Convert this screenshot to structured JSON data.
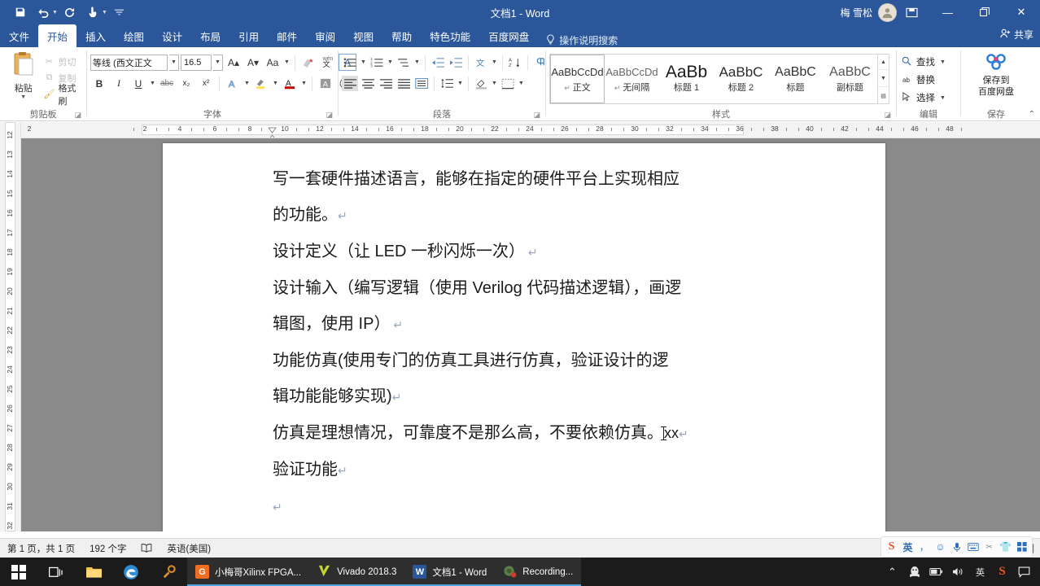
{
  "titlebar": {
    "title": "文档1 - Word",
    "user_name": "梅 雪松",
    "quick_access": [
      {
        "name": "save",
        "glyph": "Ὃe",
        "label": "保存"
      },
      {
        "name": "undo",
        "glyph": "↶",
        "label": "撤消"
      },
      {
        "name": "redo",
        "glyph": "↻",
        "label": "恢复"
      },
      {
        "name": "touch-mode",
        "glyph": "☝",
        "label": "触摸/鼠标模式"
      },
      {
        "name": "customize",
        "glyph": "≡",
        "label": "自定义快速访问工具栏"
      }
    ],
    "ribbon_display_label": "功能区显示选项",
    "minimize_label": "—",
    "restore_label": "❐",
    "close_label": "✕"
  },
  "tabs": {
    "items": [
      {
        "id": "file",
        "label": "文件",
        "active": false
      },
      {
        "id": "home",
        "label": "开始",
        "active": true
      },
      {
        "id": "insert",
        "label": "插入",
        "active": false
      },
      {
        "id": "draw",
        "label": "绘图",
        "active": false
      },
      {
        "id": "design",
        "label": "设计",
        "active": false
      },
      {
        "id": "layout",
        "label": "布局",
        "active": false
      },
      {
        "id": "references",
        "label": "引用",
        "active": false
      },
      {
        "id": "mailings",
        "label": "邮件",
        "active": false
      },
      {
        "id": "review",
        "label": "审阅",
        "active": false
      },
      {
        "id": "view",
        "label": "视图",
        "active": false
      },
      {
        "id": "help",
        "label": "帮助",
        "active": false
      },
      {
        "id": "features",
        "label": "特色功能",
        "active": false
      },
      {
        "id": "baidu",
        "label": "百度网盘",
        "active": false
      }
    ],
    "tell_me": "操作说明搜索",
    "share": "共享"
  },
  "ribbon": {
    "clipboard": {
      "group_label": "剪贴板",
      "paste_label": "粘贴",
      "items": [
        {
          "label": "剪切",
          "icon": "✂",
          "enabled": false
        },
        {
          "label": "复制",
          "icon": "⧉",
          "enabled": false
        },
        {
          "label": "格式刷",
          "icon": "✒",
          "enabled": true
        }
      ]
    },
    "font": {
      "group_label": "字体",
      "font_name": "等线 (西文正文",
      "font_size": "16.5",
      "buttons_row1": [
        {
          "name": "grow-font",
          "label": "A▴"
        },
        {
          "name": "shrink-font",
          "label": "A▾"
        },
        {
          "name": "change-case",
          "label": "Aa"
        },
        {
          "name": "clear-formatting",
          "label": "✐"
        },
        {
          "name": "phonetic-guide",
          "label": "wén文"
        },
        {
          "name": "character-border",
          "label": "A"
        }
      ],
      "buttons_row2": [
        {
          "name": "bold",
          "label": "B"
        },
        {
          "name": "italic",
          "label": "I"
        },
        {
          "name": "underline",
          "label": "U"
        },
        {
          "name": "strikethrough",
          "label": "abc"
        },
        {
          "name": "subscript",
          "label": "x₂"
        },
        {
          "name": "superscript",
          "label": "x²"
        },
        {
          "name": "text-effects",
          "label": "A"
        },
        {
          "name": "text-highlight",
          "label": "ab"
        },
        {
          "name": "font-color",
          "label": "A"
        },
        {
          "name": "character-shading",
          "label": "A"
        },
        {
          "name": "enclose-characters",
          "label": "囗"
        }
      ]
    },
    "paragraph": {
      "group_label": "段落",
      "row1": [
        {
          "name": "bullets",
          "label": "≣"
        },
        {
          "name": "numbering",
          "label": "☰"
        },
        {
          "name": "multilevel-list",
          "label": "☷"
        },
        {
          "name": "decrease-indent",
          "label": "⇤"
        },
        {
          "name": "increase-indent",
          "label": "⇥"
        },
        {
          "name": "chinese-layout",
          "label": "文"
        },
        {
          "name": "sort",
          "label": "A↓"
        },
        {
          "name": "show-formatting-marks",
          "label": "¶"
        }
      ],
      "row2": [
        {
          "name": "align-left",
          "label": "≡"
        },
        {
          "name": "align-center",
          "label": "≡"
        },
        {
          "name": "align-right",
          "label": "≡"
        },
        {
          "name": "justify",
          "label": "≡"
        },
        {
          "name": "distribute",
          "label": "☰"
        },
        {
          "name": "line-spacing",
          "label": "↕"
        },
        {
          "name": "shading",
          "label": "▲"
        },
        {
          "name": "borders",
          "label": "▦"
        }
      ]
    },
    "styles": {
      "group_label": "样式",
      "items": [
        {
          "preview": "AaBbCcDd",
          "name": "正文",
          "pilcrow": true,
          "selected": true,
          "cls": ""
        },
        {
          "preview": "AaBbCcDd",
          "name": "无间隔",
          "pilcrow": true,
          "selected": false,
          "cls": ""
        },
        {
          "preview": "AaBb",
          "name": "标题 1",
          "pilcrow": false,
          "selected": false,
          "cls": "h1"
        },
        {
          "preview": "AaBbC",
          "name": "标题 2",
          "pilcrow": false,
          "selected": false,
          "cls": "h2"
        },
        {
          "preview": "AaBbC",
          "name": "标题",
          "pilcrow": false,
          "selected": false,
          "cls": "t"
        },
        {
          "preview": "AaBbC",
          "name": "副标题",
          "pilcrow": false,
          "selected": false,
          "cls": "st"
        }
      ]
    },
    "editing": {
      "group_label": "编辑",
      "items": [
        {
          "label": "查找",
          "icon": "⌕",
          "caret": true
        },
        {
          "label": "替换",
          "icon": "ab",
          "caret": false
        },
        {
          "label": "选择",
          "icon": "➤",
          "caret": true
        }
      ]
    },
    "save_group": {
      "group_label": "保存",
      "button_label_line1": "保存到",
      "button_label_line2": "百度网盘"
    }
  },
  "rulers": {
    "tab_stop_label": "L",
    "horizontal_numbers": [
      2,
      2,
      4,
      6,
      8,
      10,
      12,
      14,
      16,
      18,
      20,
      22,
      24,
      26,
      28,
      30,
      32,
      34,
      36,
      38,
      40,
      42,
      44,
      46,
      48
    ],
    "vertical_numbers": [
      12,
      13,
      14,
      15,
      16,
      17,
      18,
      19,
      20,
      21,
      22,
      23,
      24,
      25,
      26,
      27,
      28,
      29,
      30,
      31,
      32
    ]
  },
  "document": {
    "lines": [
      {
        "text": "写一套硬件描述语言，能够在指定的硬件平台上实现相应",
        "mark": "",
        "caret": false
      },
      {
        "text": "的功能。",
        "mark": "↵",
        "caret": false
      },
      {
        "text": "设计定义（让 LED 一秒闪烁一次）",
        "mark": " ↵",
        "caret": false
      },
      {
        "text": "设计输入（编写逻辑（使用 Verilog 代码描述逻辑），画逻",
        "mark": "",
        "caret": false
      },
      {
        "text": "辑图，使用 IP）",
        "mark": " ↵",
        "caret": false
      },
      {
        "text": "功能仿真(使用专门的仿真工具进行仿真，验证设计的逻",
        "mark": "",
        "caret": false
      },
      {
        "text": "辑功能能够实现)",
        "mark": "↵",
        "caret": false
      },
      {
        "text": "仿真是理想情况，可靠度不是那么高，不要依赖仿真。",
        "mark": "↵",
        "caret": true,
        "after_caret": "xx"
      },
      {
        "text": "验证功能",
        "mark": "↵",
        "caret": false
      },
      {
        "text": "",
        "mark": "↵",
        "caret": false
      }
    ]
  },
  "statusbar": {
    "page_info": "第 1 页，共 1 页",
    "word_count": "192 个字",
    "proofing_icon": "Ὅ6",
    "language": "英语(美国)",
    "views": [
      {
        "name": "read-mode",
        "glyph": "Ὅ6",
        "active": false
      },
      {
        "name": "print-layout",
        "glyph": "▤",
        "active": true
      },
      {
        "name": "web-layout",
        "glyph": "Ὓ5",
        "active": false
      }
    ]
  },
  "ime": {
    "items": [
      {
        "name": "sogou-logo",
        "glyph": "S"
      },
      {
        "name": "language-mode",
        "glyph": "英"
      },
      {
        "name": "punctuation-mode",
        "glyph": "，"
      },
      {
        "name": "emoji",
        "glyph": "☺"
      },
      {
        "name": "voice-input",
        "glyph": "Ἲ4"
      },
      {
        "name": "soft-keyboard",
        "glyph": "⌨"
      },
      {
        "name": "screenshot",
        "glyph": "✂"
      },
      {
        "name": "toolbox",
        "glyph": "ὅ5"
      },
      {
        "name": "menu",
        "glyph": "⊞"
      }
    ]
  },
  "taskbar": {
    "start_label": "开始",
    "pinned": [
      {
        "name": "task-view",
        "glyph": "⧉"
      },
      {
        "name": "file-explorer",
        "glyph": "Ὄ1",
        "color": "#f0c14b"
      },
      {
        "name": "edge-browser",
        "glyph": "e",
        "color": "#2e8bd6"
      },
      {
        "name": "tool-app",
        "glyph": "⚒",
        "color": "#d98c2b"
      }
    ],
    "tasks": [
      {
        "label": "小梅哥Xilinx FPGA...",
        "icon_text": "G",
        "icon_color": "#ef6c20",
        "open": true
      },
      {
        "label": "Vivado 2018.3",
        "icon_text": "◢",
        "icon_color": "#b7c62c",
        "open": true
      },
      {
        "label": "文档1 - Word",
        "icon_text": "W",
        "icon_color": "#2b579a",
        "open": true
      },
      {
        "label": "Recording...",
        "icon_text": "●",
        "icon_color": "#4a7f3c",
        "open": true
      }
    ],
    "tray": [
      {
        "name": "show-hidden-icons",
        "glyph": "∧"
      },
      {
        "name": "qq-icon",
        "glyph": "ὂ7"
      },
      {
        "name": "battery-icon",
        "glyph": "ὐb"
      },
      {
        "name": "volume-icon",
        "glyph": "ὐa"
      },
      {
        "name": "ime-indicator",
        "glyph": "英"
      },
      {
        "name": "sogou-tray-icon",
        "glyph": "S"
      },
      {
        "name": "action-center-icon",
        "glyph": "▭"
      }
    ]
  },
  "colors": {
    "word_blue": "#2b579a",
    "accent": "#4fa3e3",
    "sogou_orange": "#f05822"
  }
}
